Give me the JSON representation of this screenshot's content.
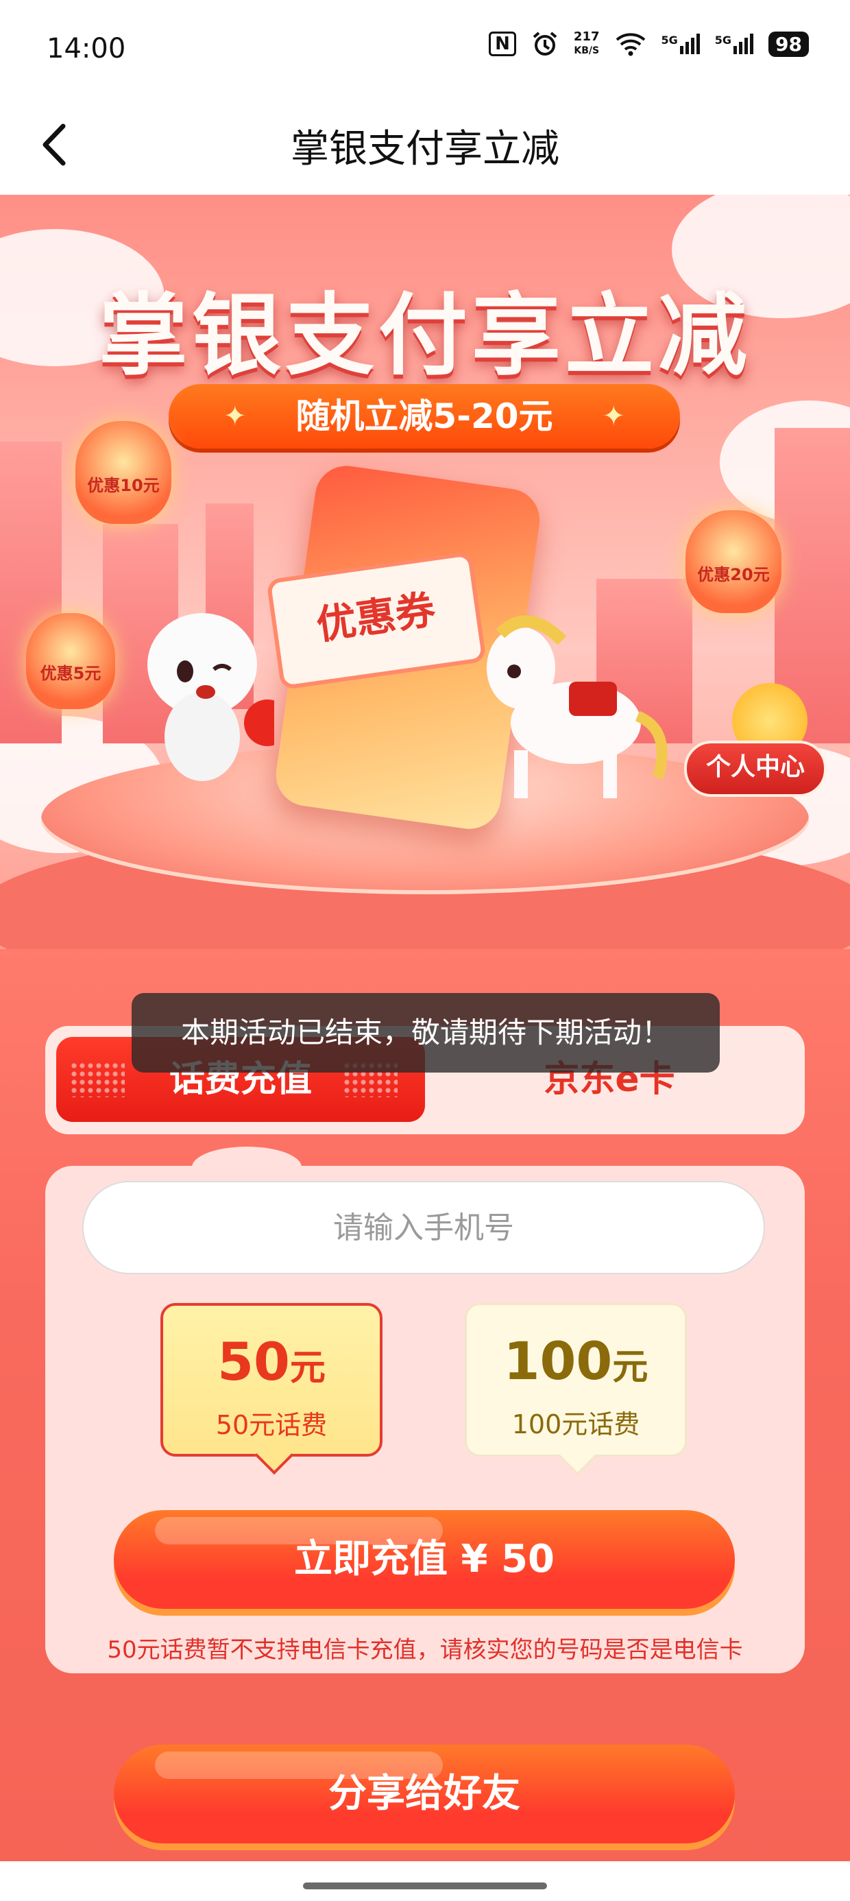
{
  "status_bar": {
    "time": "14:00",
    "nfc_icon": "N",
    "speed_value": "217",
    "speed_unit": "KB/S",
    "net1": "5G",
    "net2": "5G",
    "battery": "98"
  },
  "nav": {
    "title": "掌银支付享立减",
    "back_icon": "chevron-left-icon"
  },
  "hero": {
    "title": "掌银支付享立减",
    "subtitle": "随机立减5-20元",
    "lantern_left_top": "优惠10元",
    "lantern_left_bottom": "优惠5元",
    "lantern_right": "优惠20元",
    "coupon_text": "优惠券",
    "personal_center": "个人中心"
  },
  "toast": "本期活动已结束，敬请期待下期活动！",
  "tabs": [
    {
      "label": "话费充值",
      "active": true
    },
    {
      "label": "京东e卡",
      "active": false
    }
  ],
  "form": {
    "phone_placeholder": "请输入手机号",
    "amounts": [
      {
        "value": "50",
        "unit": "元",
        "sub": "50元话费",
        "selected": true
      },
      {
        "value": "100",
        "unit": "元",
        "sub": "100元话费",
        "selected": false
      }
    ],
    "submit_label": "立即充值 ¥ 50",
    "notice": "50元话费暂不支持电信卡充值，请核实您的号码是否是电信卡"
  },
  "share_label": "分享给好友",
  "colors": {
    "primary_red": "#e81d15",
    "accent_orange": "#ff7a2a",
    "selected_amount_text": "#e8381e",
    "normal_amount_text": "#8a6a0a"
  }
}
